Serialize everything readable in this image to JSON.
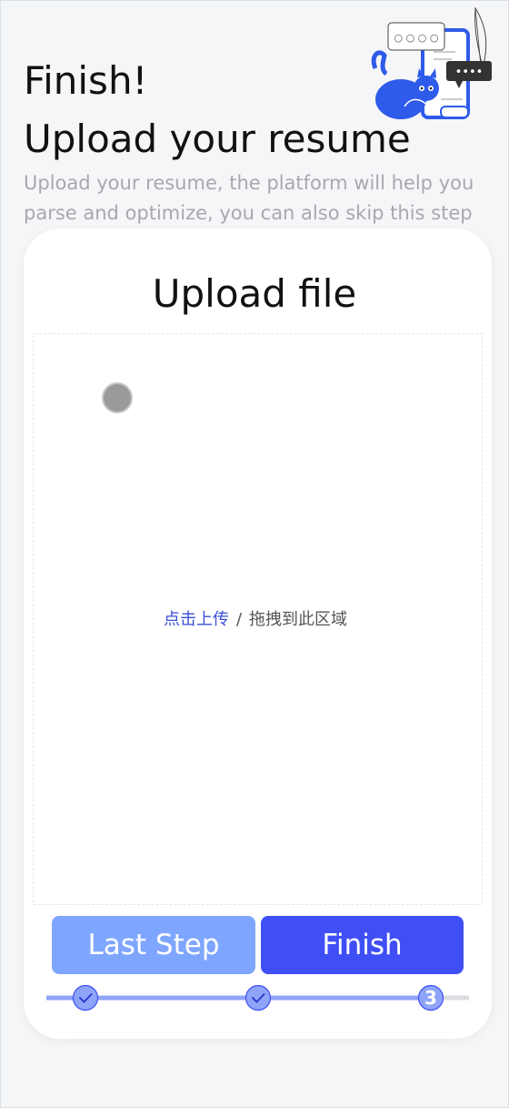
{
  "header": {
    "title": "Finish!",
    "subtitle": "Upload your resume",
    "description": "Upload your resume, the platform will help you parse and optimize, you can also skip this step"
  },
  "illustration": {
    "bubble_top": "○ ○ ○ ○",
    "bubble_dark": "••••"
  },
  "upload": {
    "title": "Upload file",
    "click_upload": "点击上传",
    "separator": "/",
    "drag_hint": "拖拽到此区域"
  },
  "actions": {
    "last_step": "Last Step",
    "finish": "Finish"
  },
  "steps": {
    "current": "3",
    "total": 3,
    "completed": 2
  },
  "colors": {
    "primary": "#3f4ff5",
    "secondary": "#7fa6ff",
    "progress_fill": "#8ea4f8",
    "progress_track": "#dcdde2",
    "link": "#3a4fd8"
  }
}
